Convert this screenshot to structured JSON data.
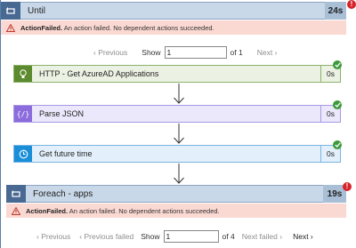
{
  "until": {
    "title": "Until",
    "duration": "24s",
    "error": {
      "code": "ActionFailed.",
      "message": " An action failed. No dependent actions succeeded."
    },
    "pager": {
      "previous": "Previous",
      "show": "Show",
      "value": "1",
      "of": "of 1",
      "next": "Next"
    }
  },
  "actions": [
    {
      "label": "HTTP - Get AzureAD Applications",
      "duration": "0s",
      "icon": "lightbulb-icon",
      "color": "#5c8a2e"
    },
    {
      "label": "Parse JSON",
      "duration": "0s",
      "icon": "curly-braces-icon",
      "color": "#8c6cdc"
    },
    {
      "label": "Get future time",
      "duration": "0s",
      "icon": "clock-icon",
      "color": "#1a8fd8"
    }
  ],
  "foreach": {
    "title": "Foreach - apps",
    "duration": "19s",
    "error": {
      "code": "ActionFailed.",
      "message": " An action failed. No dependent actions succeeded."
    },
    "pager": {
      "previous": "Previous",
      "previous_failed": "Previous failed",
      "show": "Show",
      "value": "1",
      "of": "of 4",
      "next_failed": "Next failed",
      "next": "Next"
    }
  },
  "colors": {
    "container_icon": "#486991",
    "error_badge": "#d72229",
    "success_badge": "#3c9a3c",
    "error_bar": "#fbd9d3"
  }
}
